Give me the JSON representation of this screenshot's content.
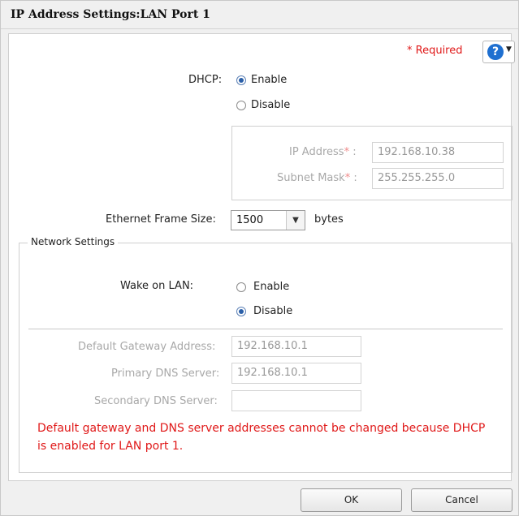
{
  "dialog": {
    "title": "IP Address Settings:LAN Port 1",
    "required_label": "* Required",
    "help_icon": "question-circle-icon"
  },
  "dhcp": {
    "label": "DHCP:",
    "options": [
      "Enable",
      "Disable"
    ],
    "selected": "Enable"
  },
  "ip_settings": {
    "ip_address_label": "IP Address",
    "ip_address_value": "192.168.10.38",
    "subnet_mask_label": "Subnet Mask",
    "subnet_mask_value": "255.255.255.0",
    "required_mark": "*",
    "colon": ":"
  },
  "ethernet_frame": {
    "label": "Ethernet Frame Size:",
    "value": "1500",
    "unit": "bytes"
  },
  "network_settings": {
    "legend": "Network Settings",
    "wake_on_lan_label": "Wake on LAN:",
    "wake_options": [
      "Enable",
      "Disable"
    ],
    "wake_selected": "Disable",
    "gateway_label": "Default Gateway Address:",
    "gateway_value": "192.168.10.1",
    "primary_dns_label": "Primary DNS Server:",
    "primary_dns_value": "192.168.10.1",
    "secondary_dns_label": "Secondary DNS Server:",
    "secondary_dns_value": "",
    "error_message": "Default gateway and DNS server addresses cannot be changed because DHCP is enabled for LAN port 1."
  },
  "buttons": {
    "ok": "OK",
    "cancel": "Cancel"
  },
  "colors": {
    "required_red": "#e01818",
    "help_blue": "#1e6fd0"
  }
}
